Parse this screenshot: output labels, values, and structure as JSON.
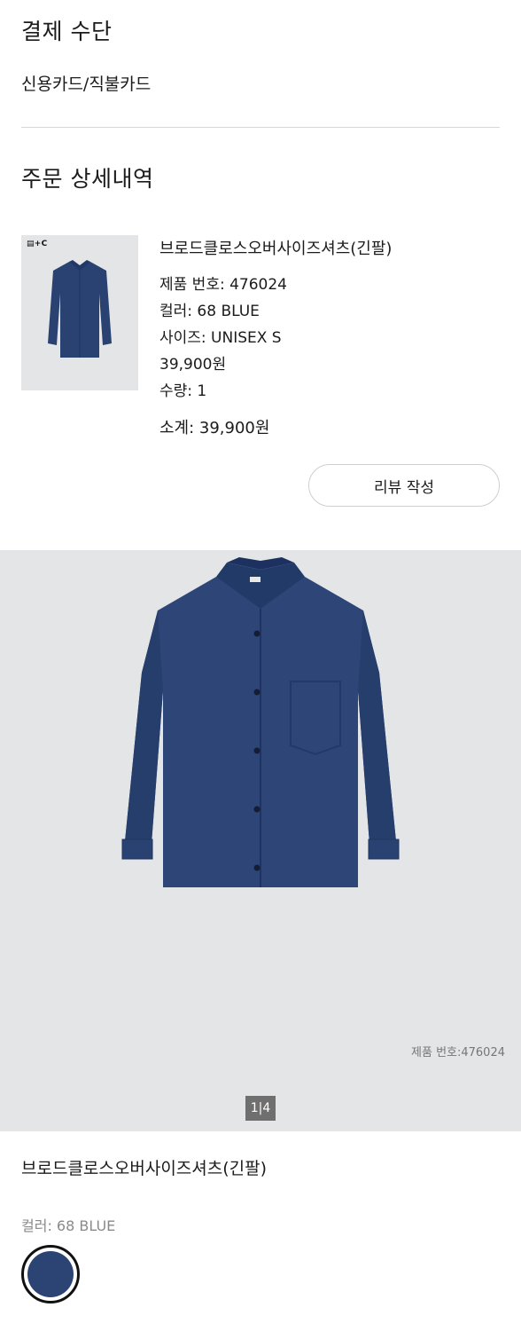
{
  "payment": {
    "title": "결제 수단",
    "method": "신용카드/직불카드"
  },
  "order": {
    "title": "주문 상세내역",
    "thumb_logo": "▤+C",
    "item": {
      "name": "브로드클로스오버사이즈셔츠(긴팔)",
      "product_no": "제품 번호: 476024",
      "color": "컬러: 68 BLUE",
      "size": "사이즈: UNISEX S",
      "price": "39,900원",
      "quantity": "수량: 1",
      "subtotal": "소계: 39,900원"
    },
    "review_button": "리뷰 작성"
  },
  "gallery": {
    "product_code": "제품 번호:476024",
    "pager": "1|4"
  },
  "product": {
    "name": "브로드클로스오버사이즈셔츠(긴팔)",
    "color_label": "컬러: 68 BLUE",
    "swatch_color": "#2c4474"
  },
  "icons": {
    "thumbnail": "shirt-thumbnail-icon",
    "main_image": "shirt-image",
    "swatch": "color-swatch-icon"
  }
}
